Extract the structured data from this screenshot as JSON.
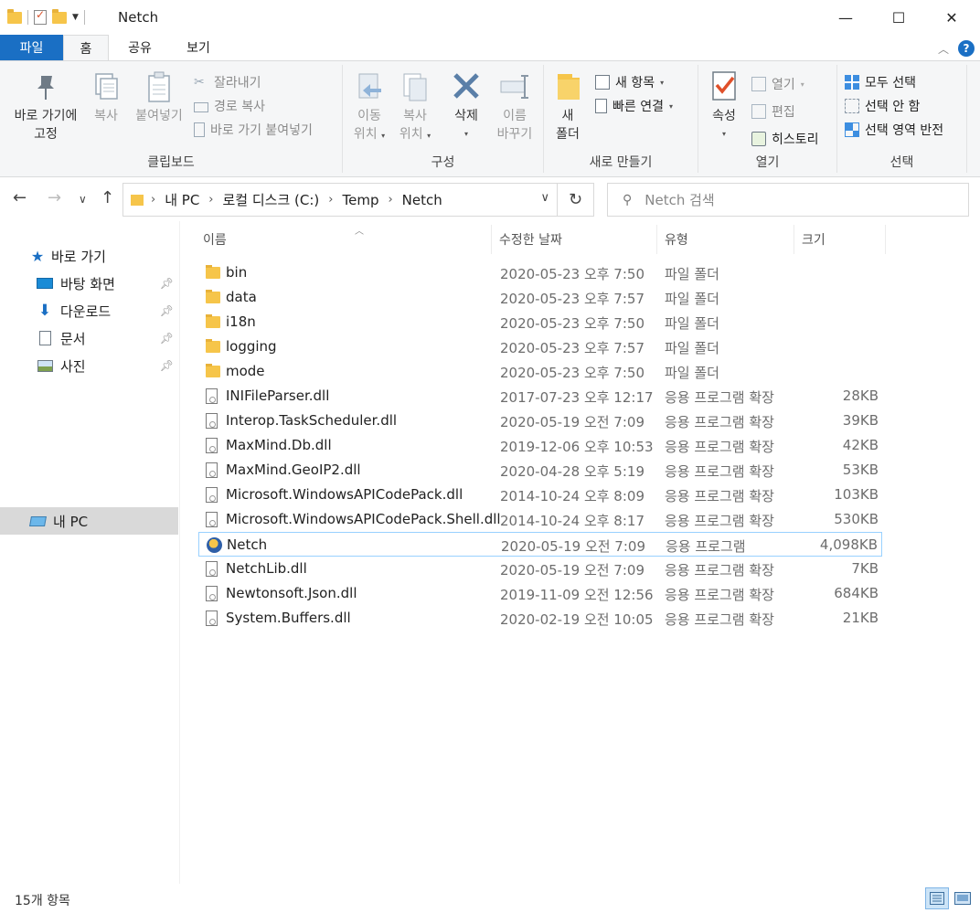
{
  "window": {
    "title": "Netch"
  },
  "window_controls": {
    "minimize": "—",
    "maximize": "☐",
    "close": "✕"
  },
  "tabs": {
    "file": "파일",
    "home": "홈",
    "share": "공유",
    "view": "보기"
  },
  "ribbon": {
    "clipboard": {
      "pin_line1": "바로 가기에",
      "pin_line2": "고정",
      "copy": "복사",
      "paste": "붙여넣기",
      "cut": "잘라내기",
      "copy_path": "경로 복사",
      "paste_shortcut": "바로 가기 붙여넣기",
      "label": "클립보드"
    },
    "organize": {
      "move_line1": "이동",
      "move_line2": "위치",
      "copy_line1": "복사",
      "copy_line2": "위치",
      "delete": "삭제",
      "rename_line1": "이름",
      "rename_line2": "바꾸기",
      "label": "구성"
    },
    "new": {
      "folder_line1": "새",
      "folder_line2": "폴더",
      "new_item": "새 항목",
      "easy_access": "빠른 연결",
      "label": "새로 만들기"
    },
    "open": {
      "properties": "속성",
      "open": "열기",
      "edit": "편집",
      "history": "히스토리",
      "label": "열기"
    },
    "select": {
      "select_all": "모두 선택",
      "select_none": "선택 안 함",
      "invert": "선택 영역 반전",
      "label": "선택"
    }
  },
  "address": {
    "crumbs": [
      "내 PC",
      "로컬 디스크 (C:)",
      "Temp",
      "Netch"
    ],
    "search_placeholder": "Netch 검색"
  },
  "sidebar": {
    "quick_access": "바로 가기",
    "items": [
      {
        "label": "바탕 화면"
      },
      {
        "label": "다운로드"
      },
      {
        "label": "문서"
      },
      {
        "label": "사진"
      }
    ],
    "this_pc": "내 PC"
  },
  "columns": {
    "name": "이름",
    "date": "수정한 날짜",
    "type": "유형",
    "size": "크기"
  },
  "files": [
    {
      "name": "bin",
      "date": "2020-05-23 오후 7:50",
      "type": "파일 폴더",
      "size": "",
      "kind": "folder"
    },
    {
      "name": "data",
      "date": "2020-05-23 오후 7:57",
      "type": "파일 폴더",
      "size": "",
      "kind": "folder"
    },
    {
      "name": "i18n",
      "date": "2020-05-23 오후 7:50",
      "type": "파일 폴더",
      "size": "",
      "kind": "folder"
    },
    {
      "name": "logging",
      "date": "2020-05-23 오후 7:57",
      "type": "파일 폴더",
      "size": "",
      "kind": "folder"
    },
    {
      "name": "mode",
      "date": "2020-05-23 오후 7:50",
      "type": "파일 폴더",
      "size": "",
      "kind": "folder"
    },
    {
      "name": "INIFileParser.dll",
      "date": "2017-07-23 오후 12:17",
      "type": "응용 프로그램 확장",
      "size": "28KB",
      "kind": "dll"
    },
    {
      "name": "Interop.TaskScheduler.dll",
      "date": "2020-05-19 오전 7:09",
      "type": "응용 프로그램 확장",
      "size": "39KB",
      "kind": "dll"
    },
    {
      "name": "MaxMind.Db.dll",
      "date": "2019-12-06 오후 10:53",
      "type": "응용 프로그램 확장",
      "size": "42KB",
      "kind": "dll"
    },
    {
      "name": "MaxMind.GeoIP2.dll",
      "date": "2020-04-28 오후 5:19",
      "type": "응용 프로그램 확장",
      "size": "53KB",
      "kind": "dll"
    },
    {
      "name": "Microsoft.WindowsAPICodePack.dll",
      "date": "2014-10-24 오후 8:09",
      "type": "응용 프로그램 확장",
      "size": "103KB",
      "kind": "dll"
    },
    {
      "name": "Microsoft.WindowsAPICodePack.Shell.dll",
      "date": "2014-10-24 오후 8:17",
      "type": "응용 프로그램 확장",
      "size": "530KB",
      "kind": "dll"
    },
    {
      "name": "Netch",
      "date": "2020-05-19 오전 7:09",
      "type": "응용 프로그램",
      "size": "4,098KB",
      "kind": "exe",
      "selected": true
    },
    {
      "name": "NetchLib.dll",
      "date": "2020-05-19 오전 7:09",
      "type": "응용 프로그램 확장",
      "size": "7KB",
      "kind": "dll"
    },
    {
      "name": "Newtonsoft.Json.dll",
      "date": "2019-11-09 오전 12:56",
      "type": "응용 프로그램 확장",
      "size": "684KB",
      "kind": "dll"
    },
    {
      "name": "System.Buffers.dll",
      "date": "2020-02-19 오전 10:05",
      "type": "응용 프로그램 확장",
      "size": "21KB",
      "kind": "dll"
    }
  ],
  "status": {
    "count": "15개 항목"
  }
}
